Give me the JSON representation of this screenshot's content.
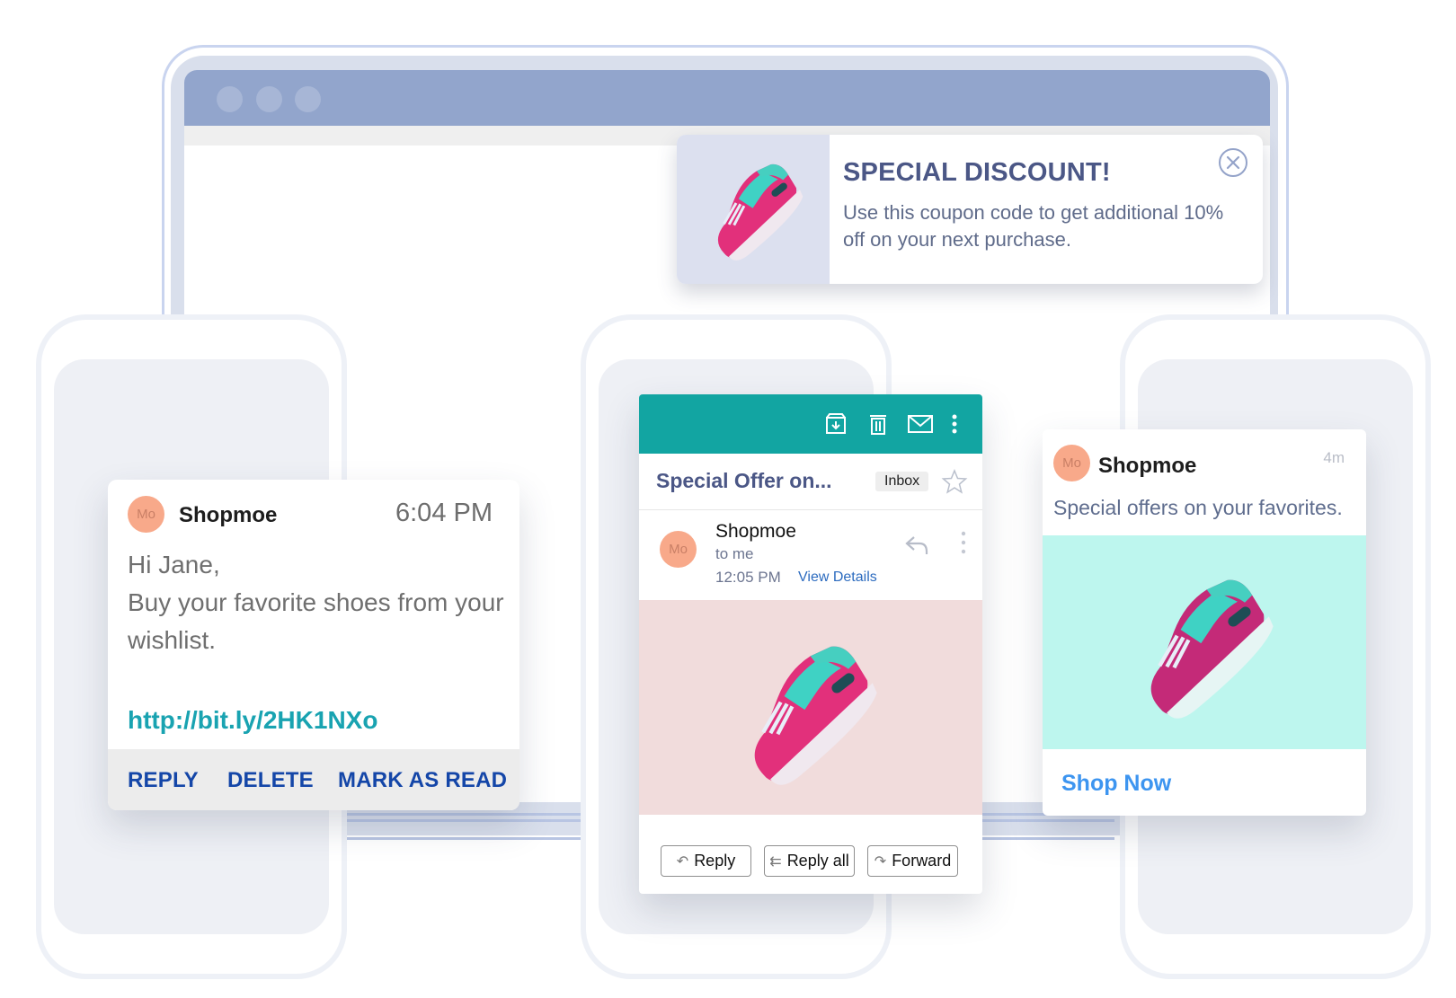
{
  "browser_window": {
    "titlebar_color": "#92a5cc",
    "window_controls": [
      "dot",
      "dot",
      "dot"
    ]
  },
  "popup": {
    "title": "SPECIAL DISCOUNT!",
    "body": "Use this coupon code to get additional 10% off on your next purchase.",
    "close_icon": "close-circle-icon",
    "image": "sneaker-illustration",
    "title_color": "#4b5786"
  },
  "sms": {
    "avatar_initials": "Mo",
    "sender": "Shopmoe",
    "time": "6:04 PM",
    "greeting": "Hi Jane,",
    "message": "Buy your favorite shoes from your wishlist.",
    "link": "http://bit.ly/2HK1NXo",
    "actions": [
      "REPLY",
      "DELETE",
      "MARK AS READ"
    ],
    "link_color": "#19a3b1",
    "action_color": "#1446a8"
  },
  "email": {
    "toolbar_icons": [
      "archive-icon",
      "trash-icon",
      "mail-icon",
      "more-vertical-icon"
    ],
    "toolbar_color": "#12a5a2",
    "subject": "Special Offer on...",
    "label": "Inbox",
    "avatar_initials": "Mo",
    "sender": "Shopmoe",
    "recipient": "to me",
    "time": "12:05 PM",
    "view_details": "View Details",
    "image": "sneaker-illustration",
    "buttons": [
      {
        "icon": "reply-icon",
        "label": "Reply"
      },
      {
        "icon": "reply-all-icon",
        "label": "Reply all"
      },
      {
        "icon": "forward-icon",
        "label": "Forward"
      }
    ]
  },
  "push": {
    "avatar_initials": "Mo",
    "sender": "Shopmoe",
    "time": "4m",
    "body": "Special offers on your favorites.",
    "image": "sneaker-illustration",
    "cta": "Shop Now",
    "cta_color": "#3d95f0"
  }
}
